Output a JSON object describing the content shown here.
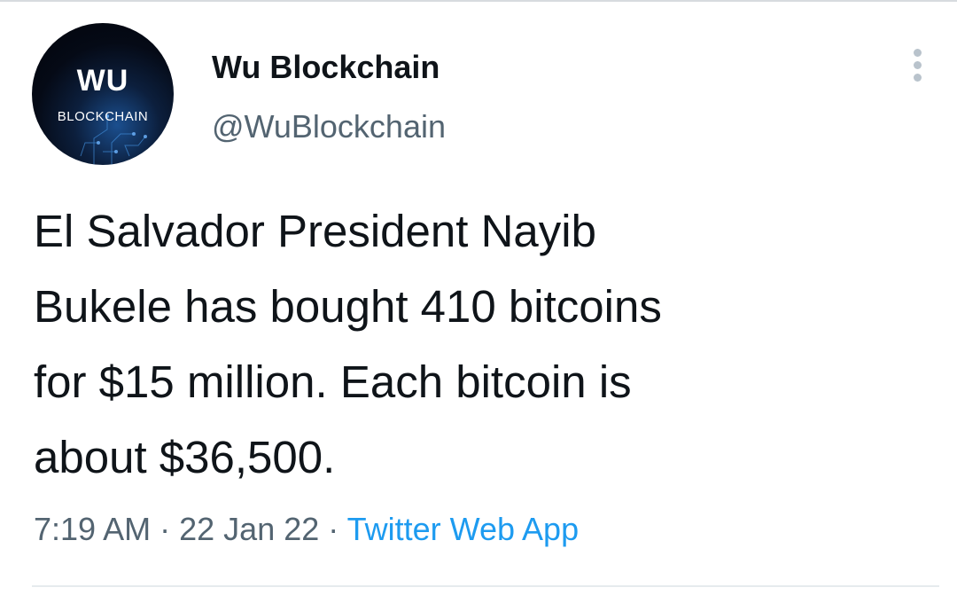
{
  "author": {
    "avatar_logo_main": "WU",
    "avatar_logo_sub": "BLOCKCHAIN",
    "display_name": "Wu Blockchain",
    "handle": "@WuBlockchain"
  },
  "more_icon": "more-vertical-icon",
  "tweet": {
    "text_lines": [
      "El Salvador President Nayib",
      "Bukele has bought 410 bitcoins",
      "for $15 million. Each bitcoin is",
      "about $36,500."
    ],
    "time": "7:19 AM",
    "separator": "·",
    "date": "22 Jan 22",
    "source": "Twitter Web App"
  },
  "colors": {
    "text_primary": "#0f1419",
    "text_secondary": "#536471",
    "link": "#1d9bf0"
  }
}
